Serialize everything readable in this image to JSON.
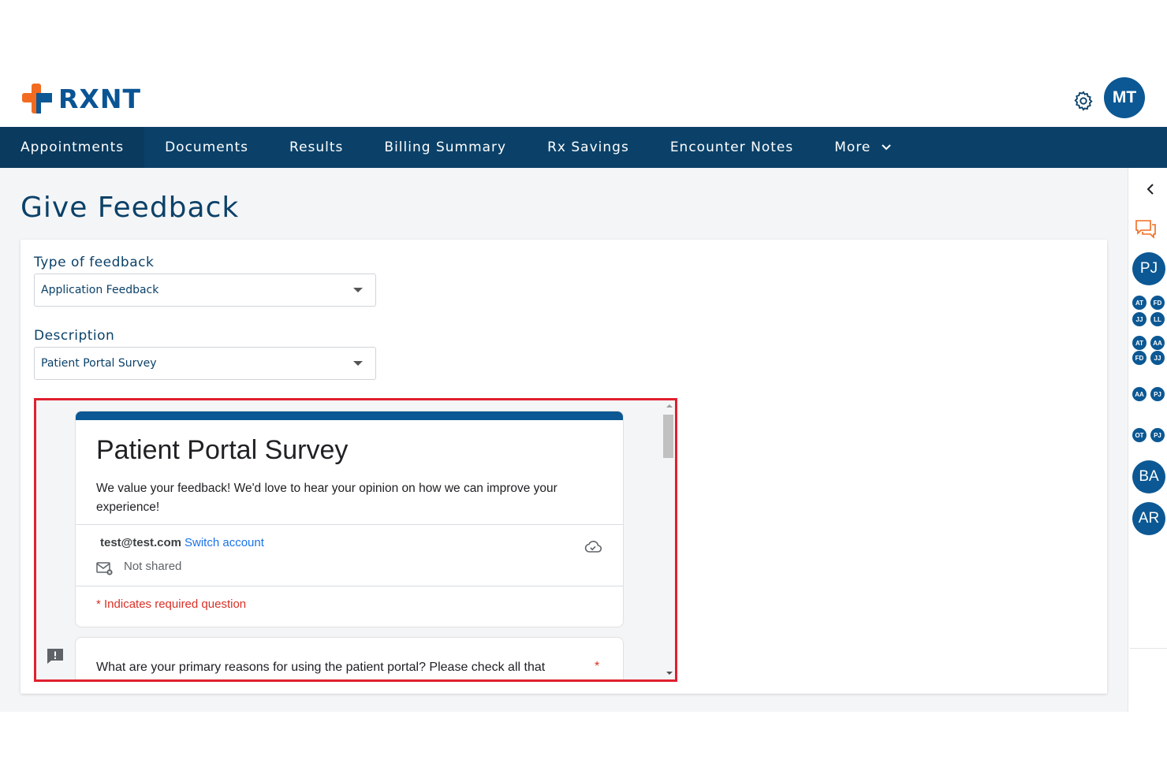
{
  "header": {
    "logo_text": "RXNT",
    "user_initials": "MT"
  },
  "nav": {
    "items": [
      {
        "label": "Appointments"
      },
      {
        "label": "Documents"
      },
      {
        "label": "Results"
      },
      {
        "label": "Billing Summary"
      },
      {
        "label": "Rx Savings"
      },
      {
        "label": "Encounter Notes"
      },
      {
        "label": "More"
      }
    ]
  },
  "page": {
    "title": "Give Feedback"
  },
  "form": {
    "type_label": "Type of feedback",
    "type_value": "Application Feedback",
    "description_label": "Description",
    "description_value": "Patient Portal Survey"
  },
  "survey": {
    "title": "Patient Portal Survey",
    "description": "We value your feedback! We'd love to hear your opinion on how we can improve your experience!",
    "account_email": "test@test.com",
    "switch_account": "Switch account",
    "not_shared": "Not shared",
    "required_note": "* Indicates required question",
    "question_text": "What are your primary reasons for using the patient portal? Please check all that",
    "question_required_mark": "*"
  },
  "rightbar": {
    "avatar_1": "PJ",
    "group_1": [
      "AT",
      "FD",
      "JJ",
      "LL"
    ],
    "group_2": [
      "AT",
      "AA",
      "FD",
      "JJ"
    ],
    "group_3": [
      "AA",
      "PJ"
    ],
    "group_4": [
      "OT",
      "PJ"
    ],
    "avatar_2": "BA",
    "avatar_3": "AR"
  },
  "colors": {
    "brand_blue": "#0b5894",
    "nav_bg": "#0b4168",
    "logo_orange": "#f26b21",
    "highlight_red": "#e0202e",
    "required_red": "#d93025",
    "link_blue": "#1a73e8"
  }
}
